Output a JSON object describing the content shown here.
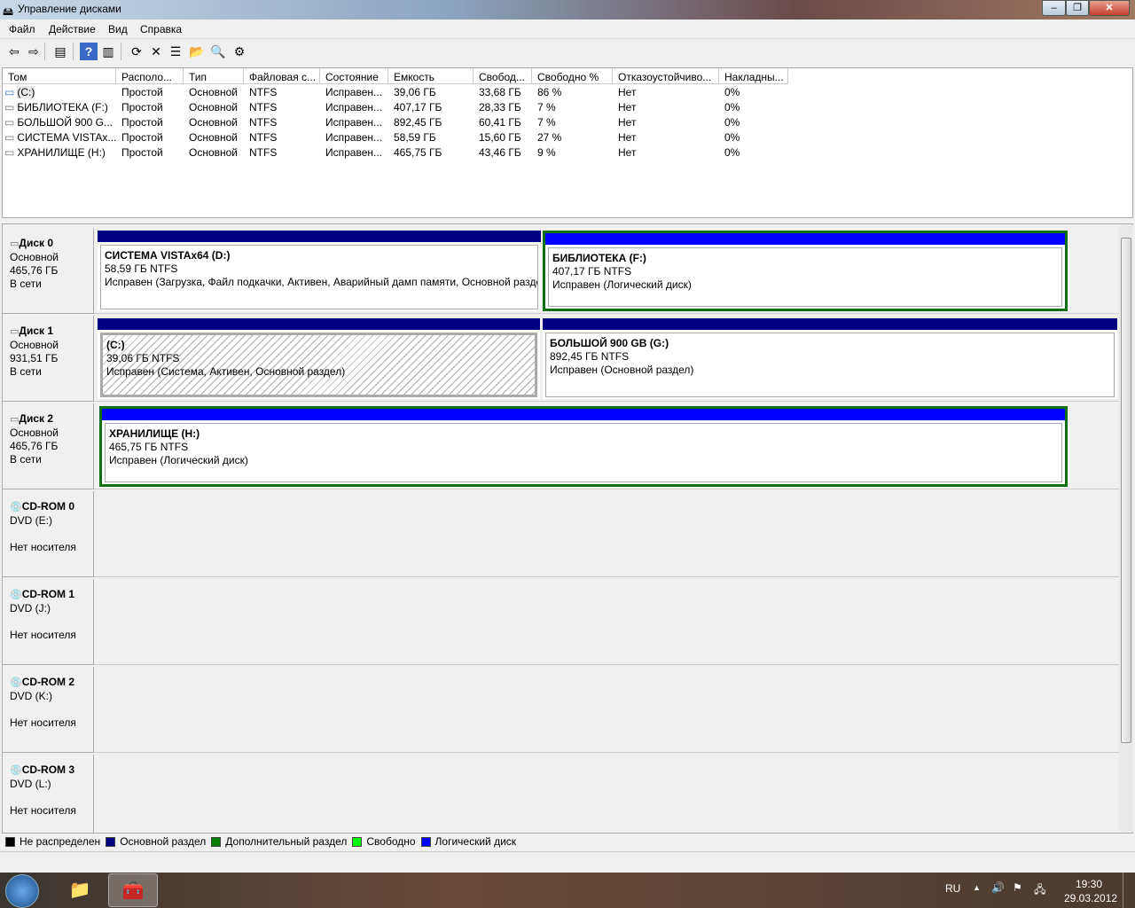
{
  "window": {
    "title": "Управление дисками"
  },
  "menu": [
    "Файл",
    "Действие",
    "Вид",
    "Справка"
  ],
  "toolbar": [
    {
      "name": "back-icon",
      "glyph": "⇦"
    },
    {
      "name": "forward-icon",
      "glyph": "⇨"
    },
    {
      "name": "show-hide-console-tree-icon",
      "glyph": "▤"
    },
    {
      "name": "help-icon",
      "glyph": "?"
    },
    {
      "name": "show-action-pane-icon",
      "glyph": "▥"
    },
    {
      "name": "refresh-icon",
      "glyph": "⟳"
    },
    {
      "name": "delete-icon",
      "glyph": "✕"
    },
    {
      "name": "properties-icon",
      "glyph": "☰"
    },
    {
      "name": "open-icon",
      "glyph": "📂"
    },
    {
      "name": "explore-icon",
      "glyph": "🔍"
    },
    {
      "name": "settings-icon",
      "glyph": "⚙"
    }
  ],
  "table": {
    "columns": [
      "Том",
      "Располо...",
      "Тип",
      "Файловая с...",
      "Состояние",
      "Емкость",
      "Свобод...",
      "Свободно %",
      "Отказоустойчиво...",
      "Накладны..."
    ],
    "rows": [
      [
        "(C:)",
        "Простой",
        "Основной",
        "NTFS",
        "Исправен...",
        "39,06 ГБ",
        "33,68 ГБ",
        "86 %",
        "Нет",
        "0%"
      ],
      [
        "БИБЛИОТЕКА (F:)",
        "Простой",
        "Основной",
        "NTFS",
        "Исправен...",
        "407,17 ГБ",
        "28,33 ГБ",
        "7 %",
        "Нет",
        "0%"
      ],
      [
        "БОЛЬШОЙ 900 G...",
        "Простой",
        "Основной",
        "NTFS",
        "Исправен...",
        "892,45 ГБ",
        "60,41 ГБ",
        "7 %",
        "Нет",
        "0%"
      ],
      [
        "СИСТЕМА VISTAx...",
        "Простой",
        "Основной",
        "NTFS",
        "Исправен...",
        "58,59 ГБ",
        "15,60 ГБ",
        "27 %",
        "Нет",
        "0%"
      ],
      [
        "ХРАНИЛИЩЕ (H:)",
        "Простой",
        "Основной",
        "NTFS",
        "Исправен...",
        "465,75 ГБ",
        "43,46 ГБ",
        "9 %",
        "Нет",
        "0%"
      ]
    ]
  },
  "disks": [
    {
      "name": "Диск 0",
      "type": "Основной",
      "size": "465,76 ГБ",
      "status": "В сети",
      "partitions": [
        {
          "title": "СИСТЕМА VISTAx64  (D:)",
          "size": "58,59 ГБ NTFS",
          "status": "Исправен (Загрузка, Файл подкачки, Активен, Аварийный дамп памяти, Основной раздел)",
          "kind": "primary"
        },
        {
          "title": "БИБЛИОТЕКА  (F:)",
          "size": "407,17 ГБ NTFS",
          "status": "Исправен (Логический диск)",
          "kind": "logical-selected"
        }
      ]
    },
    {
      "name": "Диск 1",
      "type": "Основной",
      "size": "931,51 ГБ",
      "status": "В сети",
      "partitions": [
        {
          "title": "(C:)",
          "size": "39,06 ГБ NTFS",
          "status": "Исправен (Система, Активен, Основной раздел)",
          "kind": "primary-hatched"
        },
        {
          "title": "БОЛЬШОЙ 900 GB  (G:)",
          "size": "892,45 ГБ NTFS",
          "status": "Исправен (Основной раздел)",
          "kind": "primary"
        }
      ]
    },
    {
      "name": "Диск 2",
      "type": "Основной",
      "size": "465,76 ГБ",
      "status": "В сети",
      "partitions": [
        {
          "title": "ХРАНИЛИЩЕ  (H:)",
          "size": "465,75 ГБ NTFS",
          "status": "Исправен (Логический диск)",
          "kind": "logical-selected"
        }
      ]
    },
    {
      "name": "CD-ROM 0",
      "type": "DVD (E:)",
      "size": "",
      "status": "Нет носителя",
      "partitions": []
    },
    {
      "name": "CD-ROM 1",
      "type": "DVD (J:)",
      "size": "",
      "status": "Нет носителя",
      "partitions": []
    },
    {
      "name": "CD-ROM 2",
      "type": "DVD (K:)",
      "size": "",
      "status": "Нет носителя",
      "partitions": []
    },
    {
      "name": "CD-ROM 3",
      "type": "DVD (L:)",
      "size": "",
      "status": "Нет носителя",
      "partitions": []
    }
  ],
  "legend": [
    {
      "label": "Не распределен",
      "color": "#000000"
    },
    {
      "label": "Основной раздел",
      "color": "#000080"
    },
    {
      "label": "Дополнительный раздел",
      "color": "#008000"
    },
    {
      "label": "Свободно",
      "color": "#00ff00"
    },
    {
      "label": "Логический диск",
      "color": "#0000ff"
    }
  ],
  "taskbar": {
    "lang": "RU",
    "time": "19:30",
    "date": "29.03.2012"
  }
}
